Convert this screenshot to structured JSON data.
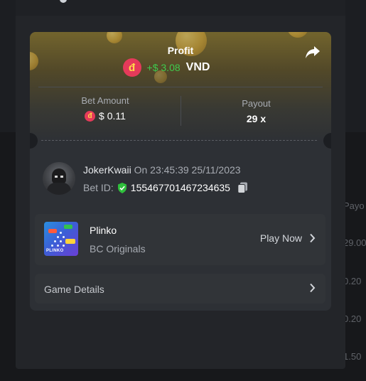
{
  "background": {
    "right_column": [
      "Payo",
      "29.00",
      "0.20",
      "0.20",
      "1.50"
    ]
  },
  "card": {
    "profit_label": "Profit",
    "token_symbol": "đ",
    "profit_value": "+$ 3.08",
    "profit_currency": "VND",
    "bet_amount_label": "Bet Amount",
    "bet_amount_value": "$ 0.11",
    "payout_label": "Payout",
    "payout_value": "29 x"
  },
  "user": {
    "username": "JokerKwaii",
    "time": "On 23:45:39 25/11/2023",
    "bet_id_label": "Bet ID:",
    "bet_id_value": "155467701467234635"
  },
  "game": {
    "name": "Plinko",
    "provider": "BC Originals",
    "play_label": "Play Now",
    "thumb_text": "PLINKO"
  },
  "details": {
    "label": "Game Details"
  },
  "colors": {
    "profit_green": "#3fcb4e",
    "token_red": "#e53a5a",
    "card_bg": "#2d3035"
  },
  "icons": {
    "share": "share-arrow-icon",
    "copy": "copy-icon",
    "shield": "verified-shield-icon",
    "chevron": "chevron-right-icon"
  }
}
